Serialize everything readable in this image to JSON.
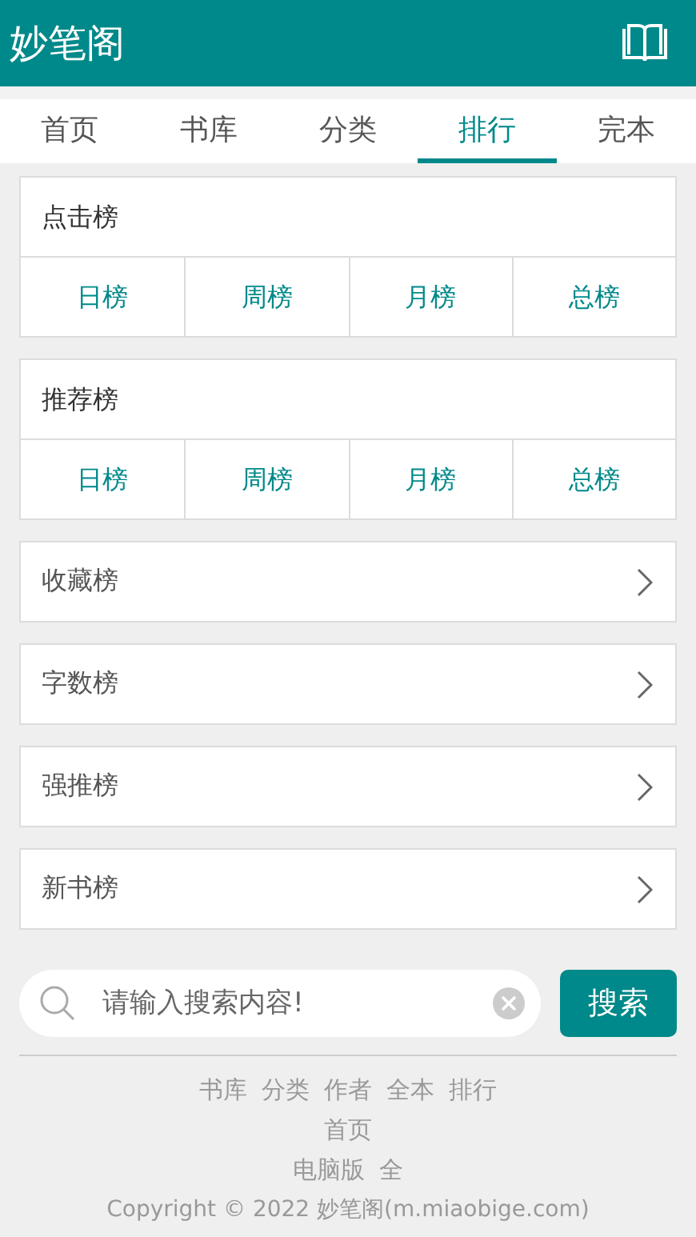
{
  "header": {
    "title": "妙笔阁"
  },
  "tabs": [
    {
      "label": "首页",
      "selected": false
    },
    {
      "label": "书库",
      "selected": false
    },
    {
      "label": "分类",
      "selected": false
    },
    {
      "label": "排行",
      "selected": true
    },
    {
      "label": "完本",
      "selected": false
    }
  ],
  "rankings": [
    {
      "kind": "grid",
      "title": "点击榜",
      "periods": [
        "日榜",
        "周榜",
        "月榜",
        "总榜"
      ]
    },
    {
      "kind": "grid",
      "title": "推荐榜",
      "periods": [
        "日榜",
        "周榜",
        "月榜",
        "总榜"
      ]
    },
    {
      "kind": "link",
      "title": "收藏榜"
    },
    {
      "kind": "link",
      "title": "字数榜"
    },
    {
      "kind": "link",
      "title": "强推榜"
    },
    {
      "kind": "link",
      "title": "新书榜"
    }
  ],
  "search": {
    "placeholder": "请输入搜索内容!",
    "button": "搜索"
  },
  "footer": {
    "link_rows": [
      [
        "书库",
        "分类",
        "作者",
        "全本",
        "排行"
      ],
      [
        "首页"
      ],
      [
        "电脑版",
        "全"
      ]
    ],
    "copyright": "Copyright © 2022 妙笔阁(m.miaobige.com)"
  }
}
